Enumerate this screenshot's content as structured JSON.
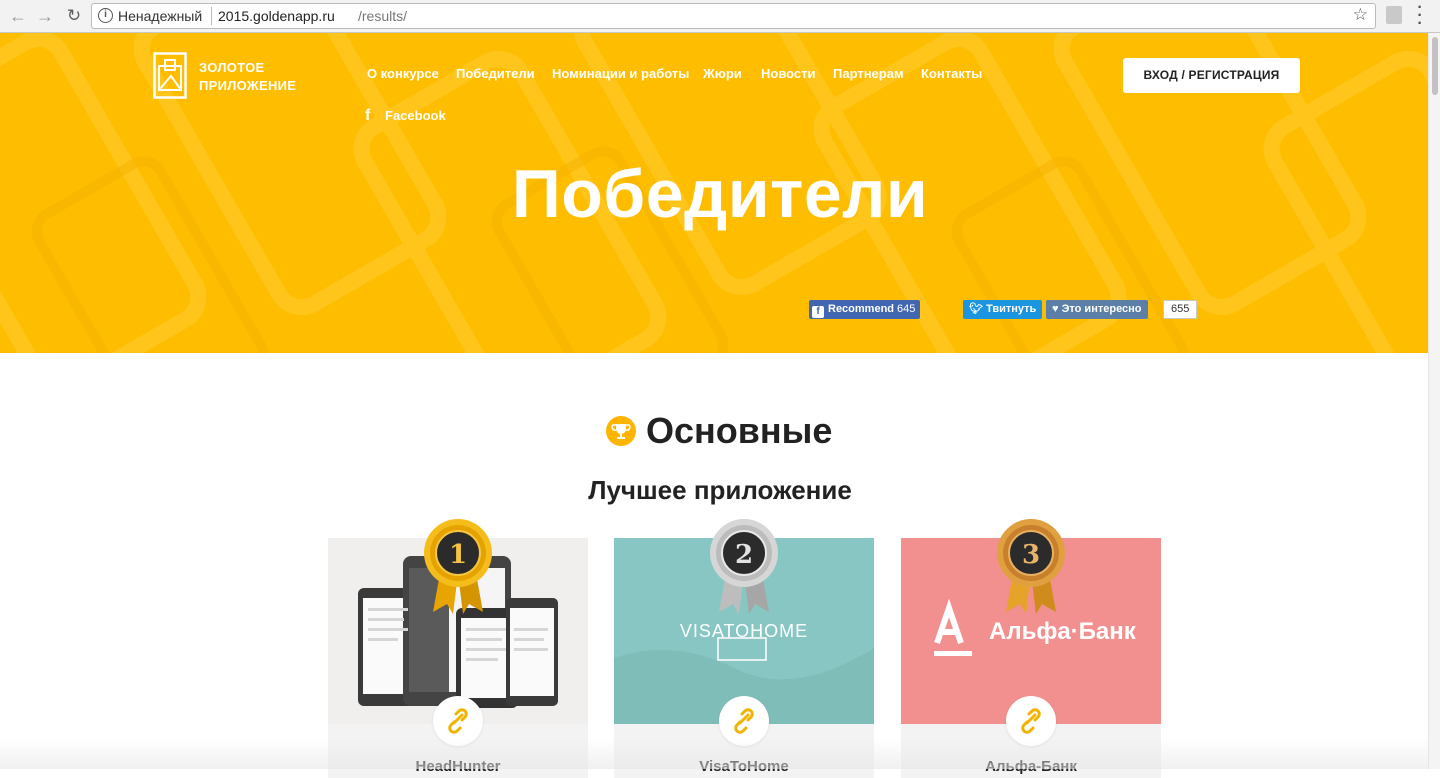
{
  "browser": {
    "insecure_label": "Ненадежный",
    "url_host": "2015.goldenapp.ru",
    "url_path": "/results/"
  },
  "logo": {
    "line1": "ЗОЛОТОЕ",
    "line2": "ПРИЛОЖЕНИЕ"
  },
  "menu": [
    {
      "label": "О конкурсе"
    },
    {
      "label": "Победители"
    },
    {
      "label": "Номинации и работы"
    },
    {
      "label": "Жюри"
    },
    {
      "label": "Новости"
    },
    {
      "label": "Партнерам"
    },
    {
      "label": "Контакты"
    }
  ],
  "facebook_label": "Facebook",
  "login_label": "ВХОД / РЕГИСТРАЦИЯ",
  "hero_title": "Победители",
  "social": {
    "fb_label": "Recommend",
    "fb_count": "645",
    "tw_label": "Твитнуть",
    "vk_label": "Это интересно",
    "vk_count": "655"
  },
  "section_title": "Основные",
  "category_title": "Лучшее приложение",
  "cards": [
    {
      "place": "1",
      "name": "HeadHunter",
      "bg": "#f0efed"
    },
    {
      "place": "2",
      "name": "VisaToHome",
      "bg": "#88c6c3",
      "img_text": "VISATOHOME"
    },
    {
      "place": "3",
      "name": "Альфа-Банк",
      "bg": "#f29090",
      "img_text": "Альфа·Банк"
    }
  ],
  "colors": {
    "accent": "#ffbd00",
    "gold": "#e8a400",
    "silver": "#b8b8b8",
    "bronze": "#c87d2a"
  }
}
